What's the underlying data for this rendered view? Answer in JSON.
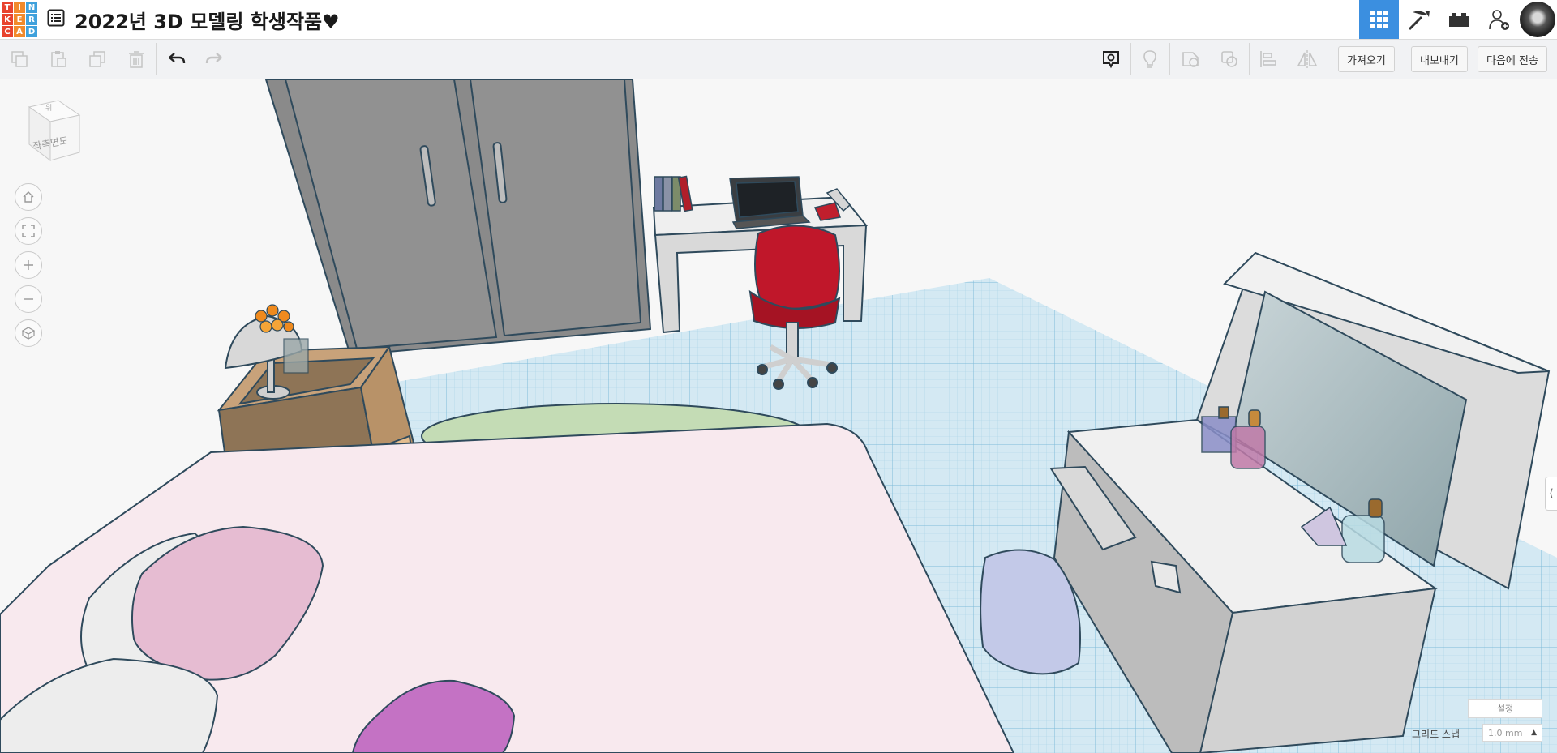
{
  "app": {
    "logo_letters": [
      "T",
      "I",
      "N",
      "K",
      "E",
      "R",
      "C",
      "A",
      "D"
    ],
    "logo_colors": [
      "#e8432e",
      "#f28a2b",
      "#3fa1dc",
      "#e8432e",
      "#f28a2b",
      "#3fa1dc",
      "#e8432e",
      "#f28a2b",
      "#3fa1dc"
    ],
    "project_title": "2022년 3D 모델링 학생작품♥"
  },
  "header_nav": {
    "items": [
      {
        "name": "3d-design-view",
        "icon": "grid-icon",
        "active": true
      },
      {
        "name": "codeblocks",
        "icon": "pickaxe-icon",
        "active": false
      },
      {
        "name": "bricks",
        "icon": "brick-icon",
        "active": false
      },
      {
        "name": "add-user",
        "icon": "add-user-icon",
        "active": false
      }
    ]
  },
  "toolbar": {
    "edit_tools": [
      "copy-icon",
      "paste-icon",
      "duplicate-icon",
      "trash-icon",
      "undo-icon",
      "redo-icon"
    ],
    "view_tools": [
      "notes-icon",
      "light-bulb-icon",
      "shape-outline-icon",
      "group-icon",
      "align-icon",
      "mirror-icon"
    ],
    "import_label": "가져오기",
    "export_label": "내보내기",
    "send_to_label": "다음에 전송"
  },
  "viewport": {
    "view_cube_label": "좌측면도",
    "view_cube_top_label": "위",
    "nav_buttons": [
      "home-icon",
      "fit-view-icon",
      "zoom-in-icon",
      "zoom-out-icon",
      "perspective-icon"
    ],
    "settings_label": "설정",
    "grid_snap_label": "그리드 스냅",
    "grid_snap_value": "1.0 mm",
    "colors": {
      "workplane": "#cfe6f2",
      "wardrobe": "#8c8c8c",
      "bed_cover": "#f7e9ee",
      "chair": "#c0172a",
      "pillow_pink": "#e6bcd2",
      "pillow_purple": "#c472c4",
      "stool": "#c3c9e8"
    }
  }
}
